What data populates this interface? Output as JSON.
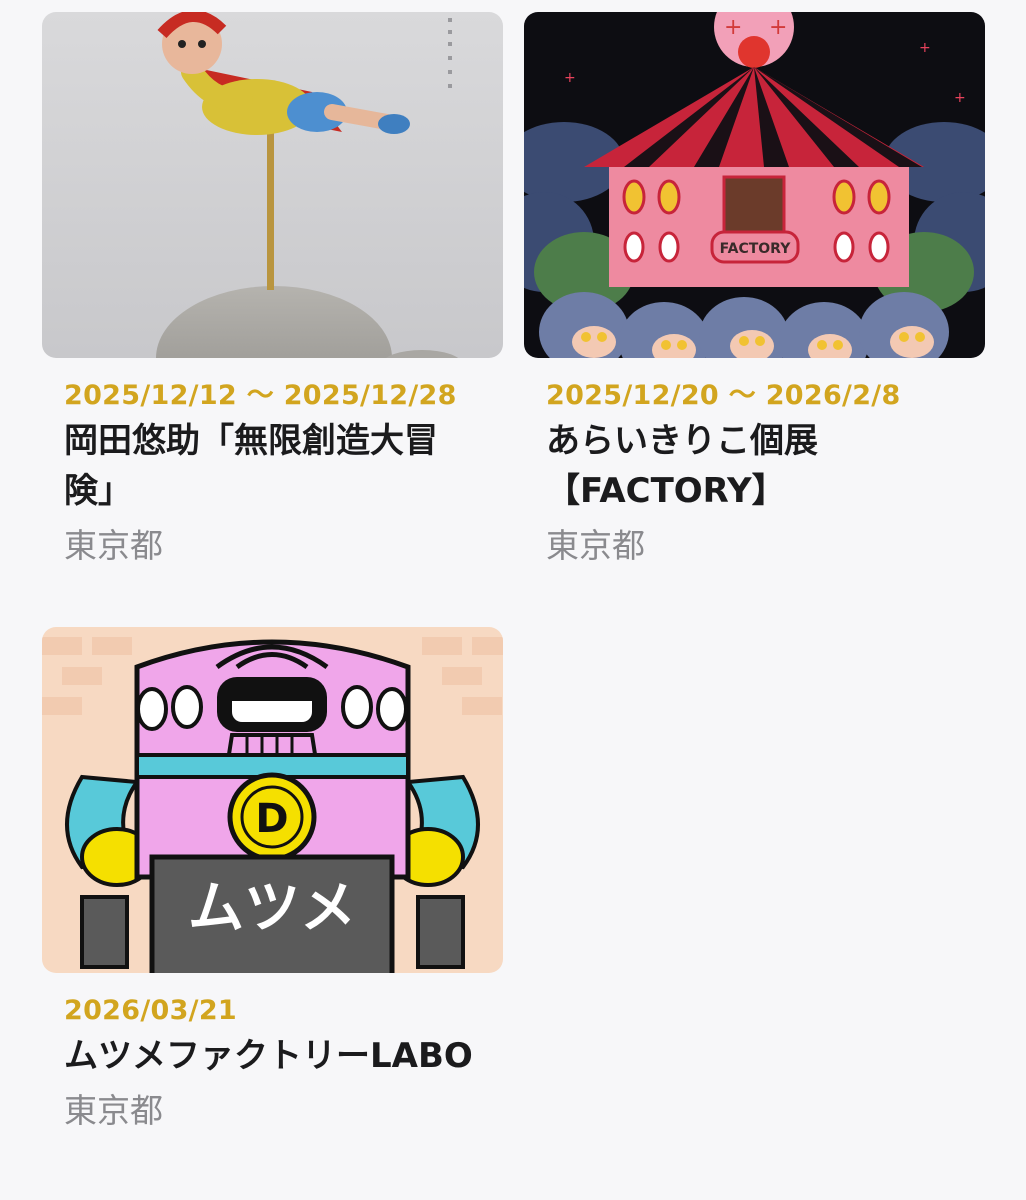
{
  "events": [
    {
      "dates": "2025/12/12 〜 2025/12/28",
      "title": "岡田悠助「無限創造大冒険」",
      "location": "東京都",
      "image_icon": "flying-figure-sculpture-image"
    },
    {
      "dates": "2025/12/20 〜 2026/2/8",
      "title": "あらいきりこ個展【FACTORY】",
      "location": "東京都",
      "image_icon": "circus-tent-illustration-image",
      "image_sign_text": "FACTORY"
    },
    {
      "dates": "2026/03/21",
      "title": "ムツメファクトリーLABO",
      "location": "東京都",
      "image_icon": "pink-robot-illustration-image",
      "image_badge_text": "D",
      "image_sign_text": "ムツメ"
    }
  ],
  "colors": {
    "background": "#f7f7f9",
    "date_accent": "#d2a51f",
    "title_text": "#1b1b1d",
    "location_text": "#8a8a8e"
  }
}
